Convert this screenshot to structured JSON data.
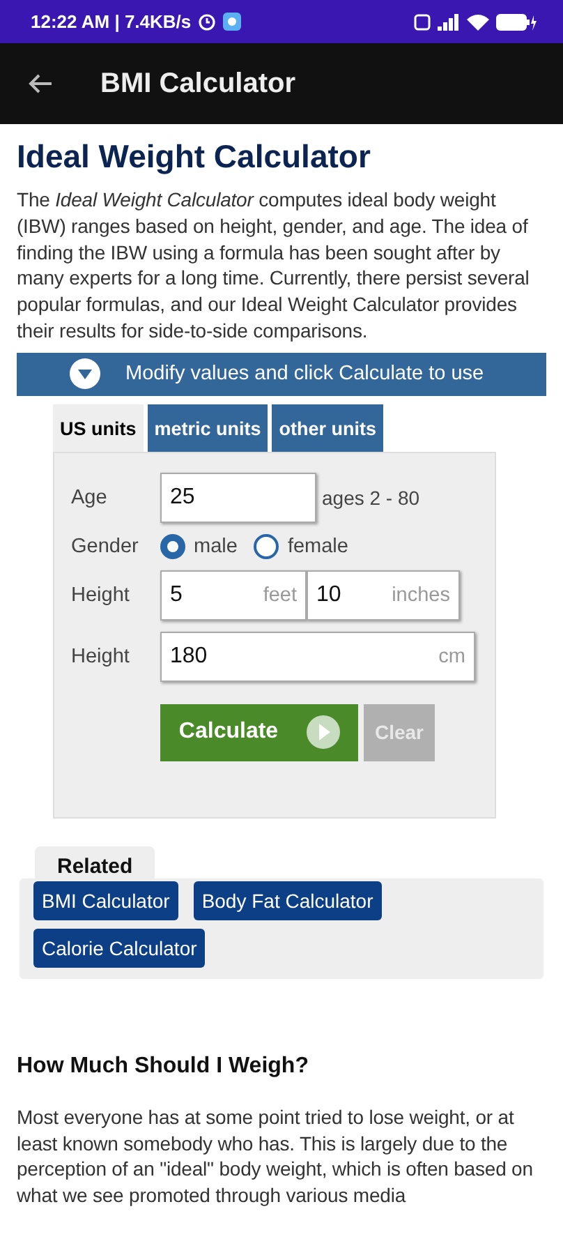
{
  "status_bar": {
    "time": "12:22 AM | 7.4KB/s"
  },
  "app_bar": {
    "title": "BMI Calculator"
  },
  "page": {
    "title": "Ideal Weight Calculator",
    "intro": "The *Ideal Weight Calculator* computes ideal body weight (IBW) ranges based on height, gender, and age. The idea of finding the IBW using a formula has been sought after by many experts for a long time. Currently, there persist several popular formulas, and our Ideal Weight Calculator provides their results for side-to-side comparisons.",
    "banner": "Modify values and click Calculate to use"
  },
  "form": {
    "tabs": [
      {
        "label": "US units",
        "selected": true
      },
      {
        "label": "metric units",
        "selected": false
      },
      {
        "label": "other units",
        "selected": false
      }
    ],
    "age": {
      "label": "Age",
      "value": "25",
      "hint": "ages 2 - 80"
    },
    "gender": {
      "label": "Gender",
      "options": [
        {
          "label": "male",
          "selected": true
        },
        {
          "label": "female",
          "selected": false
        }
      ]
    },
    "height_us": {
      "label": "Height",
      "feet": "5",
      "feet_unit": "feet",
      "inches": "10",
      "inches_unit": "inches"
    },
    "height_metric": {
      "label": "Height",
      "value": "180",
      "unit": "cm"
    },
    "calculate": "Calculate",
    "clear": "Clear"
  },
  "related": {
    "title": "Related",
    "links": [
      "BMI Calculator",
      "Body Fat Calculator",
      "Calorie Calculator"
    ]
  },
  "article": {
    "heading": "How Much Should I Weigh?",
    "text": "Most everyone has at some point tried to lose weight, or at least known somebody who has. This is largely due to the perception of an \"ideal\" body weight, which is often based on what we see promoted through various media"
  }
}
